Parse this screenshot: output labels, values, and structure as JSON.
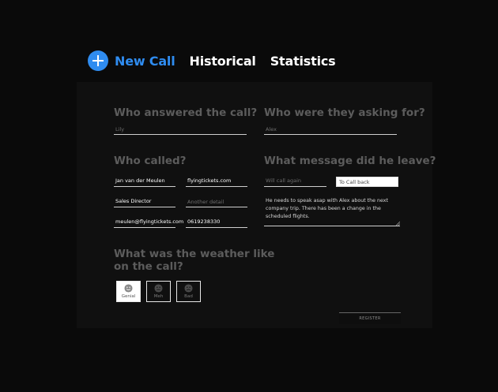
{
  "nav": {
    "tabs": [
      {
        "label": "New Call",
        "active": true
      },
      {
        "label": "Historical",
        "active": false
      },
      {
        "label": "Statistics",
        "active": false
      }
    ],
    "accent_color": "#2f8cf0",
    "add_icon": "plus-circle-icon"
  },
  "form": {
    "answered": {
      "question": "Who answered the call?",
      "placeholder": "Lily"
    },
    "asking_for": {
      "question": "Who were they asking for?",
      "placeholder": "Alex"
    },
    "caller": {
      "question": "Who called?",
      "name": "Jan van der Meulen",
      "company": "flyingtickets.com",
      "role": "Sales Director",
      "other_placeholder": "Another detail",
      "email": "meulen@flyingtickets.com",
      "phone": "0619238330"
    },
    "message": {
      "question": "What message did he leave?",
      "option_will_call": "Will call again",
      "option_call_back": "To Call back",
      "text": "He needs to speak asap with Alex about the next company trip. There has been a change in the scheduled flights."
    },
    "weather": {
      "question_line1": "What was the weather like",
      "question_line2": "on the call?",
      "options": [
        {
          "label": "Genial",
          "icon": "smile-face-icon",
          "selected": true
        },
        {
          "label": "Meh",
          "icon": "neutral-face-icon",
          "selected": false
        },
        {
          "label": "Bad",
          "icon": "sad-face-icon",
          "selected": false
        }
      ]
    },
    "register_label": "REGISTER"
  }
}
